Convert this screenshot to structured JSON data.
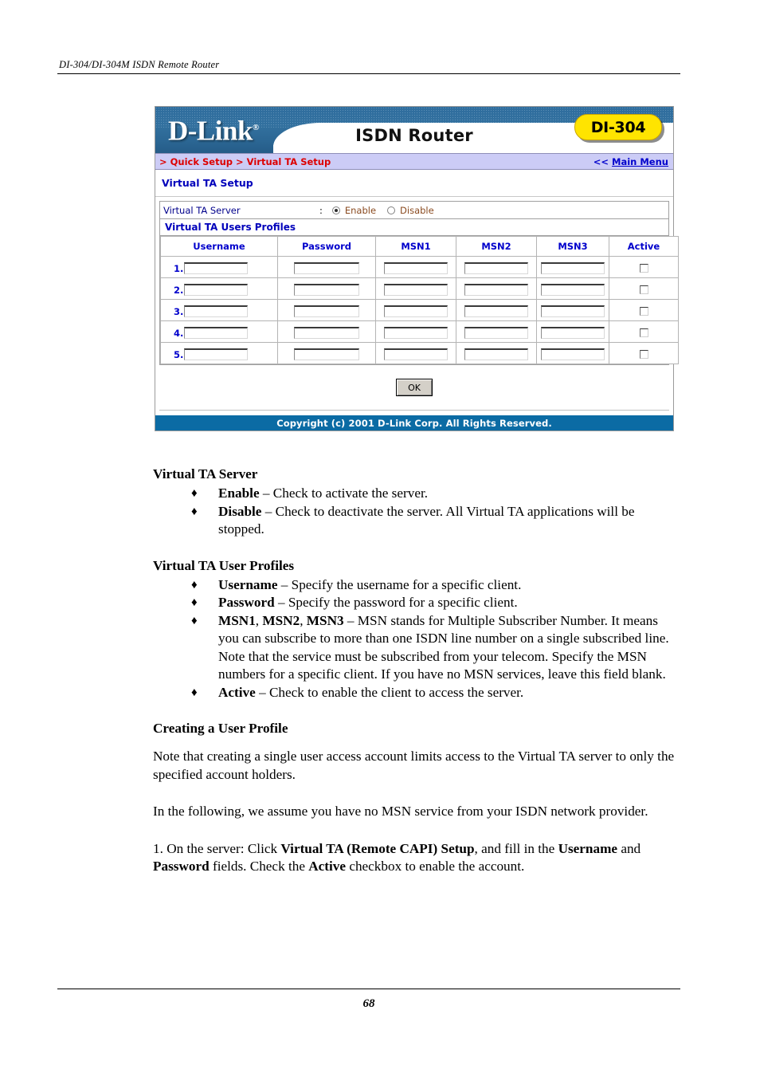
{
  "page": {
    "running_header": "DI-304/DI-304M ISDN Remote Router",
    "page_number": "68"
  },
  "router_ui": {
    "logo_text": "D-Link",
    "logo_registered": "®",
    "title": "ISDN Router",
    "model_badge": "DI-304",
    "breadcrumb": "> Quick Setup > Virtual TA Setup",
    "main_menu_arrows": "<<",
    "main_menu_label": "Main Menu",
    "section_title": "Virtual TA Setup",
    "server_row": {
      "label": "Virtual TA Server",
      "colon": ":",
      "enable_label": "Enable",
      "disable_label": "Disable",
      "selected": "Enable"
    },
    "profiles_title": "Virtual TA Users Profiles",
    "table": {
      "columns": [
        "Username",
        "Password",
        "MSN1",
        "MSN2",
        "MSN3",
        "Active"
      ],
      "rows": [
        {
          "index": "1.",
          "username": "",
          "password": "",
          "msn1": "",
          "msn2": "",
          "msn3": "",
          "active": false
        },
        {
          "index": "2.",
          "username": "",
          "password": "",
          "msn1": "",
          "msn2": "",
          "msn3": "",
          "active": false
        },
        {
          "index": "3.",
          "username": "",
          "password": "",
          "msn1": "",
          "msn2": "",
          "msn3": "",
          "active": false
        },
        {
          "index": "4.",
          "username": "",
          "password": "",
          "msn1": "",
          "msn2": "",
          "msn3": "",
          "active": false
        },
        {
          "index": "5.",
          "username": "",
          "password": "",
          "msn1": "",
          "msn2": "",
          "msn3": "",
          "active": false
        }
      ]
    },
    "ok_button": "OK",
    "footer": "Copyright (c) 2001 D-Link Corp. All Rights Reserved.",
    "colors": {
      "banner_blue": "#2f6d9e",
      "badge_yellow": "#ffe400",
      "breadcrumb_bg": "#ccccf6",
      "breadcrumb_text": "#dd0000",
      "link_blue": "#0000cc",
      "footer_blue": "#0b6ba4",
      "radio_label": "#8a4b20"
    }
  },
  "doc": {
    "bullet_glyph": "♦",
    "section1": {
      "heading": "Virtual TA Server",
      "items": [
        {
          "term": "Enable",
          "dash": " – ",
          "text": "Check to activate the server."
        },
        {
          "term": "Disable",
          "dash": " – ",
          "text": "Check to deactivate the server. All Virtual TA applications will be stopped."
        }
      ]
    },
    "section2": {
      "heading": "Virtual TA User Profiles",
      "items": [
        {
          "term": "Username",
          "dash": " – ",
          "text": "Specify the username for a specific client."
        },
        {
          "term": "Password",
          "dash": " – ",
          "text": "Specify the password for a specific client."
        },
        {
          "term": "MSN1",
          "term2": "MSN2",
          "term3": "MSN3",
          "dash": " – ",
          "text": "MSN stands for Multiple Subscriber Number. It means you can subscribe to more than one ISDN line number on a single subscribed line. Note that the service must be subscribed from your telecom. Specify the MSN numbers for a specific client. If you have no MSN services, leave this field blank."
        },
        {
          "term": "Active",
          "dash": " – ",
          "text": "Check to enable the client to access the server."
        }
      ]
    },
    "section3": {
      "heading": "Creating a User Profile",
      "para1": "Note that creating a single user access account limits access to the Virtual TA server to only the specified account holders.",
      "para2": "In the following, we assume you have no MSN service from your ISDN network provider.",
      "step1": {
        "prefix": "1. On the server: Click ",
        "bold1": "Virtual TA (Remote CAPI) Setup",
        "mid1": ", and fill in the ",
        "bold2": "Username",
        "mid2": " and ",
        "bold3": "Password",
        "mid3": " fields. Check the ",
        "bold4": "Active",
        "suffix": " checkbox to enable the account."
      }
    }
  }
}
